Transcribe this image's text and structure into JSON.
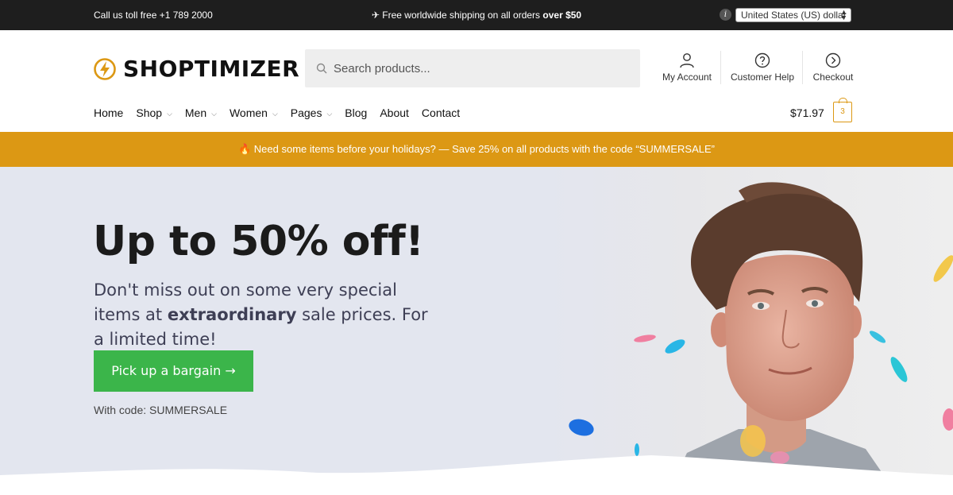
{
  "topbar": {
    "phone_text": "Call us toll free +1 789 2000",
    "shipping_text": "✈ Free worldwide shipping on all orders ",
    "shipping_bold": "over $50",
    "info_icon": "i",
    "currency_selected": "United States (US) dollar"
  },
  "header": {
    "logo_text": "SHOPTIMIZER",
    "search_placeholder": "Search products...",
    "links": [
      {
        "label": "My Account",
        "icon": "user-icon"
      },
      {
        "label": "Customer Help",
        "icon": "help-circle-icon"
      },
      {
        "label": "Checkout",
        "icon": "arrow-circle-right-icon"
      }
    ]
  },
  "nav": {
    "items": [
      {
        "label": "Home",
        "dropdown": false
      },
      {
        "label": "Shop",
        "dropdown": true
      },
      {
        "label": "Men",
        "dropdown": true
      },
      {
        "label": "Women",
        "dropdown": true
      },
      {
        "label": "Pages",
        "dropdown": true
      },
      {
        "label": "Blog",
        "dropdown": false
      },
      {
        "label": "About",
        "dropdown": false
      },
      {
        "label": "Contact",
        "dropdown": false
      }
    ],
    "cart_total": "$71.97",
    "cart_count": "3"
  },
  "promo": {
    "text": "🔥 Need some items before your holidays? — Save 25% on all products with the code “SUMMERSALE”"
  },
  "hero": {
    "title": "Up to 50% off!",
    "subtitle_1": "Don't miss out on some very special items at ",
    "subtitle_bold": "extraordinary",
    "subtitle_2": " sale prices. For a limited time!",
    "button_label": "Pick up a bargain →",
    "code_text": "With code: SUMMERSALE"
  },
  "colors": {
    "accent": "#dc9814",
    "cta_green": "#3bb54a",
    "topbar_bg": "#1e1e1e",
    "hero_bg": "#e3e6ef"
  }
}
